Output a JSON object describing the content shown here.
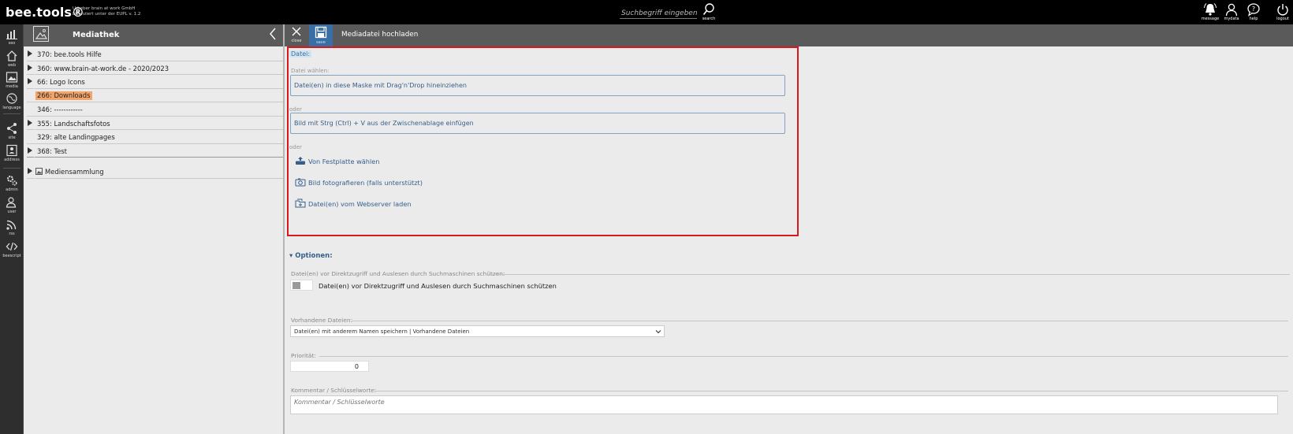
{
  "app": {
    "logo": "bee.tools®",
    "license_line1": "Urheber brain at work GmbH",
    "license_line2": "Lizenziert unter der EUPL v. 1.2"
  },
  "topbar": {
    "search_placeholder": "Suchbegriff eingeben",
    "search_label": "search",
    "buttons": [
      {
        "label": "message",
        "icon": "bell-icon"
      },
      {
        "label": "mydata",
        "icon": "user-icon"
      },
      {
        "label": "help",
        "icon": "help-bubble-icon"
      },
      {
        "label": "logout",
        "icon": "power-icon"
      }
    ]
  },
  "leftnav": [
    {
      "label": "seo",
      "icon": "chart-icon"
    },
    {
      "label": "web",
      "icon": "home-icon"
    },
    {
      "label": "media",
      "icon": "image-icon"
    },
    {
      "label": "language",
      "icon": "globe-icon"
    },
    {
      "label": "site",
      "icon": "sitemap-icon"
    },
    {
      "label": "address",
      "icon": "contact-card-icon"
    },
    {
      "label": "admin",
      "icon": "gears-icon"
    },
    {
      "label": "user",
      "icon": "user-gear-icon"
    },
    {
      "label": "rss",
      "icon": "rss-icon"
    },
    {
      "label": "beescript",
      "icon": "code-icon"
    }
  ],
  "panel": {
    "title": "Mediathek",
    "tree": [
      {
        "label": "370: bee.tools Hilfe",
        "expandable": true,
        "active": false
      },
      {
        "label": "360: www.brain-at-work.de - 2020/2023",
        "expandable": true,
        "active": false
      },
      {
        "label": "66: Logo Icons",
        "expandable": true,
        "active": false
      },
      {
        "label": "266: Downloads",
        "expandable": false,
        "active": true
      },
      {
        "label": "346: ------------",
        "expandable": false,
        "active": false
      },
      {
        "label": "355: Landschaftsfotos",
        "expandable": true,
        "active": false
      },
      {
        "label": "329: alte Landingpages",
        "expandable": false,
        "active": false
      },
      {
        "label": "368: Test",
        "expandable": true,
        "active": false
      }
    ],
    "collection": "Mediensammlung"
  },
  "main": {
    "close_label": "close",
    "save_label": "save",
    "title": "Mediadatei hochladen",
    "datei_label": "Datei:",
    "choose_label": "Datei wählen:",
    "dropzone_text": "Datei(en) in diese Maske mit Drag'n'Drop hineinziehen",
    "or1": "oder",
    "paste_text": "Bild mit Strg (Ctrl) + V aus der Zwischenablage einfügen",
    "or2": "oder",
    "actions": [
      {
        "label": "Von Festplatte wählen",
        "icon": "upload-drive-icon"
      },
      {
        "label": "Bild fotografieren (falls unterstützt)",
        "icon": "camera-icon"
      },
      {
        "label": "Datei(en) vom Webserver laden",
        "icon": "server-folder-icon"
      }
    ],
    "options_label": "▾ Optionen:",
    "protect_label": "Datei(en) vor Direktzugriff und Auslesen durch Suchmaschinen schützen:",
    "protect_toggle_label": "Datei(en) vor Direktzugriff und Auslesen durch Suchmaschinen schützen",
    "existing_label": "Vorhandene Dateien:",
    "existing_value": "Datei(en) mit anderem Namen speichern | Vorhandene Dateien",
    "priority_label": "Priorität:",
    "priority_value": "0",
    "comment_label": "Kommentar / Schlüsselworte:",
    "comment_placeholder": "Kommentar / Schlüsselworte"
  },
  "colors": {
    "accent": "#3a6fa6",
    "highlight": "#f2a46b",
    "frame": "#d7191f"
  }
}
